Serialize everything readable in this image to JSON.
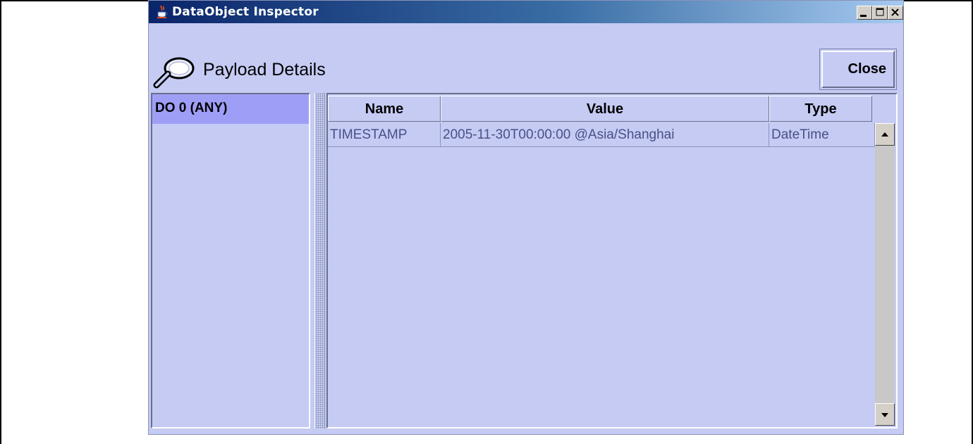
{
  "window": {
    "title": "DataObject Inspector",
    "icons": {
      "app": "java-cup-icon",
      "minimize": "minimize-icon",
      "maximize": "maximize-icon",
      "close": "close-x-icon"
    }
  },
  "header": {
    "title": "Payload Details",
    "icon": "magnifier-icon",
    "close_label": "Close"
  },
  "tree": {
    "items": [
      {
        "label": "DO 0 (ANY)",
        "selected": true
      }
    ]
  },
  "table": {
    "columns": [
      "Name",
      "Value",
      "Type"
    ],
    "rows": [
      {
        "name": "TIMESTAMP",
        "value": "2005-11-30T00:00:00 @Asia/Shanghai",
        "type": "DateTime"
      }
    ]
  },
  "colors": {
    "panel_bg": "#c5cbf3",
    "selection": "#9f9ef7",
    "cell_text": "#4a4f86",
    "titlebar_start": "#0a246a"
  }
}
